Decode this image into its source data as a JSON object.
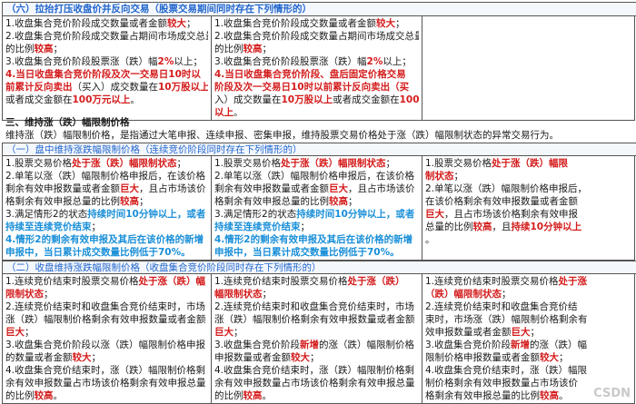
{
  "sec6": {
    "header": "（六）拉抬打压收盘价并反向交易（股票交易期间同时存在下列情形的）",
    "cols": [
      {
        "lines": [
          [
            {
              "t": "1.收盘集合竞价阶段成交数量或者金额"
            },
            {
              "t": "较大",
              "c": "red"
            },
            {
              "t": "；"
            }
          ],
          [
            {
              "t": "2.收盘集合竞价阶段成交数量占期间市场成交总量"
            }
          ],
          [
            {
              "t": "的比例"
            },
            {
              "t": "较高",
              "c": "red"
            },
            {
              "t": "；"
            }
          ],
          [
            {
              "t": "3.收盘集合竞价阶段股票涨（跌）幅"
            },
            {
              "t": "2%",
              "c": "red"
            },
            {
              "t": "以上；"
            }
          ],
          [
            {
              "t": "4.当日收盘集合竞价阶段及次一交易日10时以",
              "c": "red"
            }
          ],
          [
            {
              "t": "前",
              "c": "red"
            },
            {
              "t": "累计反向卖出",
              "c": "red"
            },
            {
              "t": "（买入）成交数量在"
            },
            {
              "t": "10万股以上",
              "c": "red"
            }
          ],
          [
            {
              "t": "或者成交金额在"
            },
            {
              "t": "100万元以上",
              "c": "red"
            },
            {
              "t": "。"
            }
          ]
        ]
      },
      {
        "lines": [
          [
            {
              "t": "1.收盘集合竞价阶段成交数量或者金额"
            },
            {
              "t": "较大",
              "c": "red"
            },
            {
              "t": "；"
            }
          ],
          [
            {
              "t": "2.收盘集合竞价阶段成交数量占期间市场成交总量"
            }
          ],
          [
            {
              "t": "的比例"
            },
            {
              "t": "较高",
              "c": "red"
            },
            {
              "t": "；"
            }
          ],
          [
            {
              "t": "3.收盘集合竞价阶段股票涨（跌）幅"
            },
            {
              "t": "2%",
              "c": "red"
            },
            {
              "t": "以上；"
            }
          ],
          [
            {
              "t": "4.当日收盘集合竞价阶段",
              "c": "red"
            },
            {
              "t": "、盘后固定价格交易",
              "c": "red"
            }
          ],
          [
            {
              "t": "阶段及次一交易日10时以前",
              "c": "red"
            },
            {
              "t": "累计反向卖出（买",
              "c": "red"
            }
          ],
          [
            {
              "t": "入）成交数量在"
            },
            {
              "t": "10万股以上",
              "c": "red"
            },
            {
              "t": "或者成交金额在"
            },
            {
              "t": "100万元",
              "c": "red"
            }
          ],
          [
            {
              "t": "以上",
              "c": "red"
            },
            {
              "t": "。"
            }
          ]
        ]
      },
      {
        "lines": []
      }
    ]
  },
  "sec3": {
    "title": "三、维持涨（跌）幅限制价格",
    "desc": "维持涨（跌）幅限制价格，是指通过大笔申报、连续申报、密集申报，维持股票交易价格处于涨（跌）幅限制状态的异常交易行为。"
  },
  "sub1": {
    "header": "（一）盘中维持涨跌幅限制价格（连续竞价阶段同时存在下列情形的）",
    "cols": [
      {
        "lines": [
          [
            {
              "t": "1.股票交易价格"
            },
            {
              "t": "处于涨（跌）幅限制状态",
              "c": "red"
            },
            {
              "t": "；"
            }
          ],
          [
            {
              "t": "2.单笔以涨（跌）幅限制价格申报后，在该价格"
            }
          ],
          [
            {
              "t": "剩余有效申报数量或者金额"
            },
            {
              "t": "巨大",
              "c": "red"
            },
            {
              "t": "，且占市场该价"
            }
          ],
          [
            {
              "t": "格剩余有效申报总量的比例"
            },
            {
              "t": "较高",
              "c": "red"
            },
            {
              "t": "；"
            }
          ],
          [
            {
              "t": "3.满足情形2的状态"
            },
            {
              "t": "持续时间10分钟以上，或者",
              "c": "bl"
            }
          ],
          [
            {
              "t": "持续至连续竞价结束",
              "c": "bl"
            },
            {
              "t": "；"
            }
          ],
          [
            {
              "t": "4.情形2的剩余有效申报及其后在该价格的新增",
              "c": "bl"
            }
          ],
          [
            {
              "t": "申报中，当日累计成交数量比例低于70%。",
              "c": "bl"
            }
          ]
        ]
      },
      {
        "lines": [
          [
            {
              "t": "1.股票交易价格"
            },
            {
              "t": "处于涨（跌）幅限制状态",
              "c": "red"
            },
            {
              "t": "；"
            }
          ],
          [
            {
              "t": "2.单笔以涨（跌）幅限制价格申报后，在该价格"
            }
          ],
          [
            {
              "t": "剩余有效申报数量或者金额"
            },
            {
              "t": "巨大",
              "c": "red"
            },
            {
              "t": "，且占市场该价"
            }
          ],
          [
            {
              "t": "格剩余有效申报总量的比例"
            },
            {
              "t": "较高",
              "c": "red"
            },
            {
              "t": "；"
            }
          ],
          [
            {
              "t": "3.满足情形2的状态"
            },
            {
              "t": "持续时间10分钟以上，或者",
              "c": "bl"
            }
          ],
          [
            {
              "t": "持续至连续竞价结束",
              "c": "bl"
            },
            {
              "t": "；"
            }
          ],
          [
            {
              "t": "4.情形2的剩余有效申报及其后在该价格的新增",
              "c": "bl"
            }
          ],
          [
            {
              "t": "申报中，当日累计成交数量比例低于70%。",
              "c": "bl"
            }
          ]
        ]
      },
      {
        "lines": [
          [
            {
              "t": "1.股票交易价格"
            },
            {
              "t": "处于涨（跌）幅限",
              "c": "red"
            }
          ],
          [
            {
              "t": "制状态",
              "c": "red"
            },
            {
              "t": "；"
            }
          ],
          [
            {
              "t": "2.单笔以涨（跌）幅限制价格申报后，"
            }
          ],
          [
            {
              "t": "在该价格剩余有效申报数量或者金额"
            }
          ],
          [
            {
              "t": "巨大",
              "c": "red"
            },
            {
              "t": "，且占市场该价格剩余有效申报"
            }
          ],
          [
            {
              "t": "总量的比例"
            },
            {
              "t": "较高",
              "c": "red"
            },
            {
              "t": "，且"
            },
            {
              "t": "持续10分钟以上",
              "c": "red"
            }
          ],
          [
            {
              "t": "。"
            }
          ]
        ]
      }
    ]
  },
  "sub2": {
    "header": "（二）收盘维持涨跌幅限制价格（收盘集合竞价阶段同时存在下列情形的）",
    "cols": [
      {
        "lines": [
          [
            {
              "t": "1.连续竞价结束时股票交易价格"
            },
            {
              "t": "处于涨（跌）幅",
              "c": "red"
            }
          ],
          [
            {
              "t": "限制状态",
              "c": "red"
            },
            {
              "t": "；"
            }
          ],
          [
            {
              "t": "2.连续竞价结束时和收盘集合竞价结束时，市场"
            }
          ],
          [
            {
              "t": "涨（跌）幅限制价格剩余有效申报数量或者金额"
            }
          ],
          [
            {
              "t": "巨大",
              "c": "red"
            },
            {
              "t": "；"
            }
          ],
          [
            {
              "t": "3.收盘集合竞价阶段以涨（跌）幅限制价格申报"
            }
          ],
          [
            {
              "t": "的数量或者金额"
            },
            {
              "t": "较大",
              "c": "red"
            },
            {
              "t": "；"
            }
          ],
          [
            {
              "t": "4.收盘集合竞价结束时，涨（跌）幅限制价格剩"
            }
          ],
          [
            {
              "t": "余有效申报数量占市场该价格剩余有效申报总量"
            }
          ],
          [
            {
              "t": "的比例"
            },
            {
              "t": "较高",
              "c": "red"
            },
            {
              "t": "。"
            }
          ]
        ]
      },
      {
        "lines": [
          [
            {
              "t": "1.连续竞价结束时股票交易价格"
            },
            {
              "t": "处于涨（跌）",
              "c": "red"
            }
          ],
          [
            {
              "t": "幅限制状态",
              "c": "red"
            },
            {
              "t": "；"
            }
          ],
          [
            {
              "t": "2.连续竞价结束时和收盘集合竞价结束时，市场"
            }
          ],
          [
            {
              "t": "涨（跌）幅限制价格剩余有效申报数量或者金额"
            }
          ],
          [
            {
              "t": "巨大",
              "c": "red"
            },
            {
              "t": "；"
            }
          ],
          [
            {
              "t": "3.收盘集合竞价阶段"
            },
            {
              "t": "新增",
              "c": "red"
            },
            {
              "t": "的涨（跌）幅限制价格"
            }
          ],
          [
            {
              "t": "申报数量或者金额"
            },
            {
              "t": "较大",
              "c": "red"
            },
            {
              "t": "；"
            }
          ],
          [
            {
              "t": "4.收盘集合竞价结束时，涨（跌）幅限制价格剩"
            }
          ],
          [
            {
              "t": "余有效申报数量占市场该价格剩余有效申报总量"
            }
          ],
          [
            {
              "t": "的比例"
            },
            {
              "t": "较高",
              "c": "red"
            },
            {
              "t": "。"
            }
          ]
        ]
      },
      {
        "lines": [
          [
            {
              "t": "1.连续竞价结束时股票交易价格"
            },
            {
              "t": "处于涨",
              "c": "red"
            }
          ],
          [
            {
              "t": "（跌）幅限制状态",
              "c": "red"
            },
            {
              "t": "；"
            }
          ],
          [
            {
              "t": "2.连续竞价结束时和收盘集合竞价结"
            }
          ],
          [
            {
              "t": "束时，市场涨（跌）幅限制价格剩余有"
            }
          ],
          [
            {
              "t": "效申报数量或者金额"
            },
            {
              "t": "巨大",
              "c": "red"
            },
            {
              "t": "；"
            }
          ],
          [
            {
              "t": "3.收盘集合竞价阶段"
            },
            {
              "t": "新增",
              "c": "red"
            },
            {
              "t": "的涨（跌）幅"
            }
          ],
          [
            {
              "t": "限制价格申报数量或者金额"
            },
            {
              "t": "较大",
              "c": "red"
            },
            {
              "t": "；"
            }
          ],
          [
            {
              "t": "4.收盘集合竞价结束时，涨（跌）幅限"
            }
          ],
          [
            {
              "t": "制价格剩余有效申报数量占市场该价"
            }
          ],
          [
            {
              "t": "格剩余有效申报总量的比例"
            },
            {
              "t": "较高",
              "c": "red"
            },
            {
              "t": "。"
            }
          ]
        ]
      }
    ]
  },
  "watermark": "CSDN"
}
